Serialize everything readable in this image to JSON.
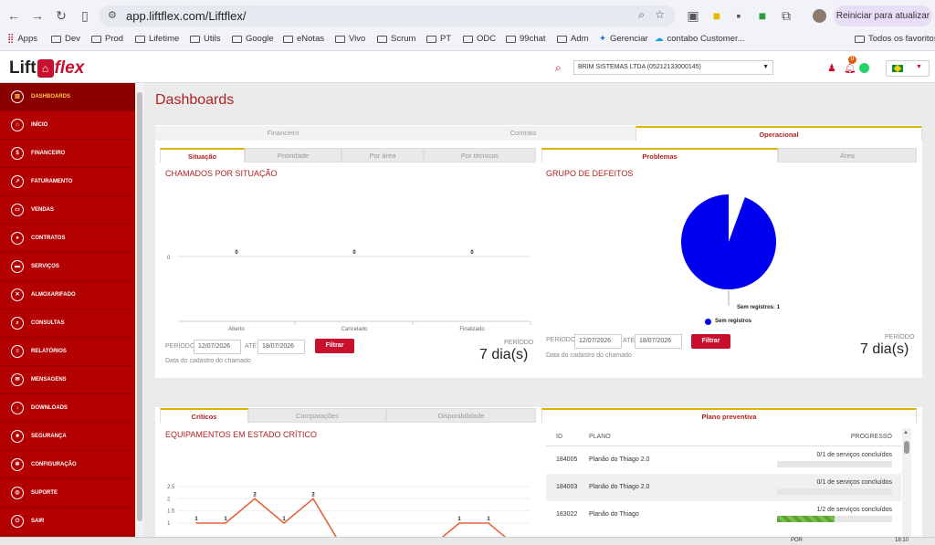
{
  "browser": {
    "url": "app.liftflex.com/Liftflex/",
    "update_label": "Reiniciar para atualizar",
    "bookmarks": [
      "Apps",
      "Dev",
      "Prod",
      "Lifetime",
      "Utils",
      "Google",
      "eNotas",
      "Vivo",
      "Scrum",
      "PT",
      "ODC",
      "99chat",
      "Adm",
      "Gerenciar",
      "contabo Customer...",
      "Todos os favoritos"
    ]
  },
  "header": {
    "logo_left": "Lift",
    "logo_mid": "⌂",
    "logo_right": "flex",
    "company": "BRIM SISTEMAS LTDA (05212133000145)",
    "notif_count": "0"
  },
  "sidebar": {
    "items": [
      {
        "label": "Dashboards",
        "icon": "dashboard-icon"
      },
      {
        "label": "Início",
        "icon": "home-icon"
      },
      {
        "label": "Financeiro",
        "icon": "money-icon"
      },
      {
        "label": "Faturamento",
        "icon": "chart-icon"
      },
      {
        "label": "Vendas",
        "icon": "folder-icon"
      },
      {
        "label": "Contratos",
        "icon": "user-icon"
      },
      {
        "label": "Serviços",
        "icon": "briefcase-icon"
      },
      {
        "label": "Almoxarifado",
        "icon": "wrench-icon"
      },
      {
        "label": "Consultas",
        "icon": "search-icon"
      },
      {
        "label": "Relatórios",
        "icon": "report-icon"
      },
      {
        "label": "Mensagens",
        "icon": "mail-icon"
      },
      {
        "label": "Downloads",
        "icon": "download-icon"
      },
      {
        "label": "Segurança",
        "icon": "lock-icon"
      },
      {
        "label": "Configuração",
        "icon": "gear-icon"
      },
      {
        "label": "Suporte",
        "icon": "support-icon"
      },
      {
        "label": "Sair",
        "icon": "power-icon"
      }
    ]
  },
  "page": {
    "title": "Dashboards"
  },
  "main_tabs": [
    "Financeiro",
    "Contrato",
    "Operacional"
  ],
  "situacao": {
    "tabs": [
      "Situação",
      "Prioridade",
      "Por área",
      "Por técnicos"
    ],
    "title": "CHAMADOS POR SITUAÇÃO",
    "periodo_label": "PERÍODO",
    "ate_label": "ATÉ",
    "date_from": "12/07/2026",
    "date_to": "18/07/2026",
    "filter_label": "Filtrar",
    "hint": "Data do cadastro do chamado",
    "periodo_right": "PERÍODO",
    "period_value": "7 dia(s)"
  },
  "defeitos": {
    "tabs": [
      "Problemas",
      "Área"
    ],
    "title": "GRUPO DE DEFEITOS",
    "pie_label": "Sem registros: 1",
    "legend": "Sem registros",
    "periodo_label": "PERÍODO",
    "ate_label": "ATÉ",
    "date_from": "12/07/2026",
    "date_to": "18/07/2026",
    "filter_label": "Filtrar",
    "hint": "Data do cadastro do chamado",
    "periodo_right": "PERÍODO",
    "period_value": "7 dia(s)"
  },
  "criticos": {
    "tabs": [
      "Críticos",
      "Comparações",
      "Disponibilidade"
    ],
    "title": "EQUIPAMENTOS EM ESTADO CRÍTICO"
  },
  "plano": {
    "tab": "Plano preventiva",
    "headers": [
      "ID",
      "PLANO",
      "PROGRESSO"
    ],
    "rows": [
      {
        "id": "184005",
        "plano": "Planão do Thiago 2.0",
        "progress": "0/1 de serviços concluídos",
        "frac": 0
      },
      {
        "id": "184003",
        "plano": "Planão do Thiago 2.0",
        "progress": "0/1 de serviços concluídos",
        "frac": 0
      },
      {
        "id": "183022",
        "plano": "Planão do Thiago",
        "progress": "1/2 de serviços concluídos",
        "frac": 0.5
      }
    ]
  },
  "chart_data": [
    {
      "type": "bar",
      "title": "CHAMADOS POR SITUAÇÃO",
      "categories": [
        "Aberto",
        "Cancelado",
        "Finalizado"
      ],
      "values": [
        0,
        0,
        0
      ],
      "ytick": "0"
    },
    {
      "type": "pie",
      "title": "GRUPO DE DEFEITOS",
      "slices": [
        {
          "name": "Sem registros",
          "value": 1,
          "color": "#0000ee"
        }
      ]
    },
    {
      "type": "line",
      "title": "EQUIPAMENTOS EM ESTADO CRÍTICO",
      "values": [
        1,
        1,
        2,
        1,
        2,
        0,
        0,
        0,
        0,
        1,
        1,
        0
      ],
      "yticks": [
        "2.5",
        "2",
        "1.5",
        "1"
      ],
      "ylim": [
        1,
        2.5
      ],
      "color": "#e8623c"
    }
  ],
  "taskbar": {
    "time": "18:10",
    "lang": "POR"
  }
}
